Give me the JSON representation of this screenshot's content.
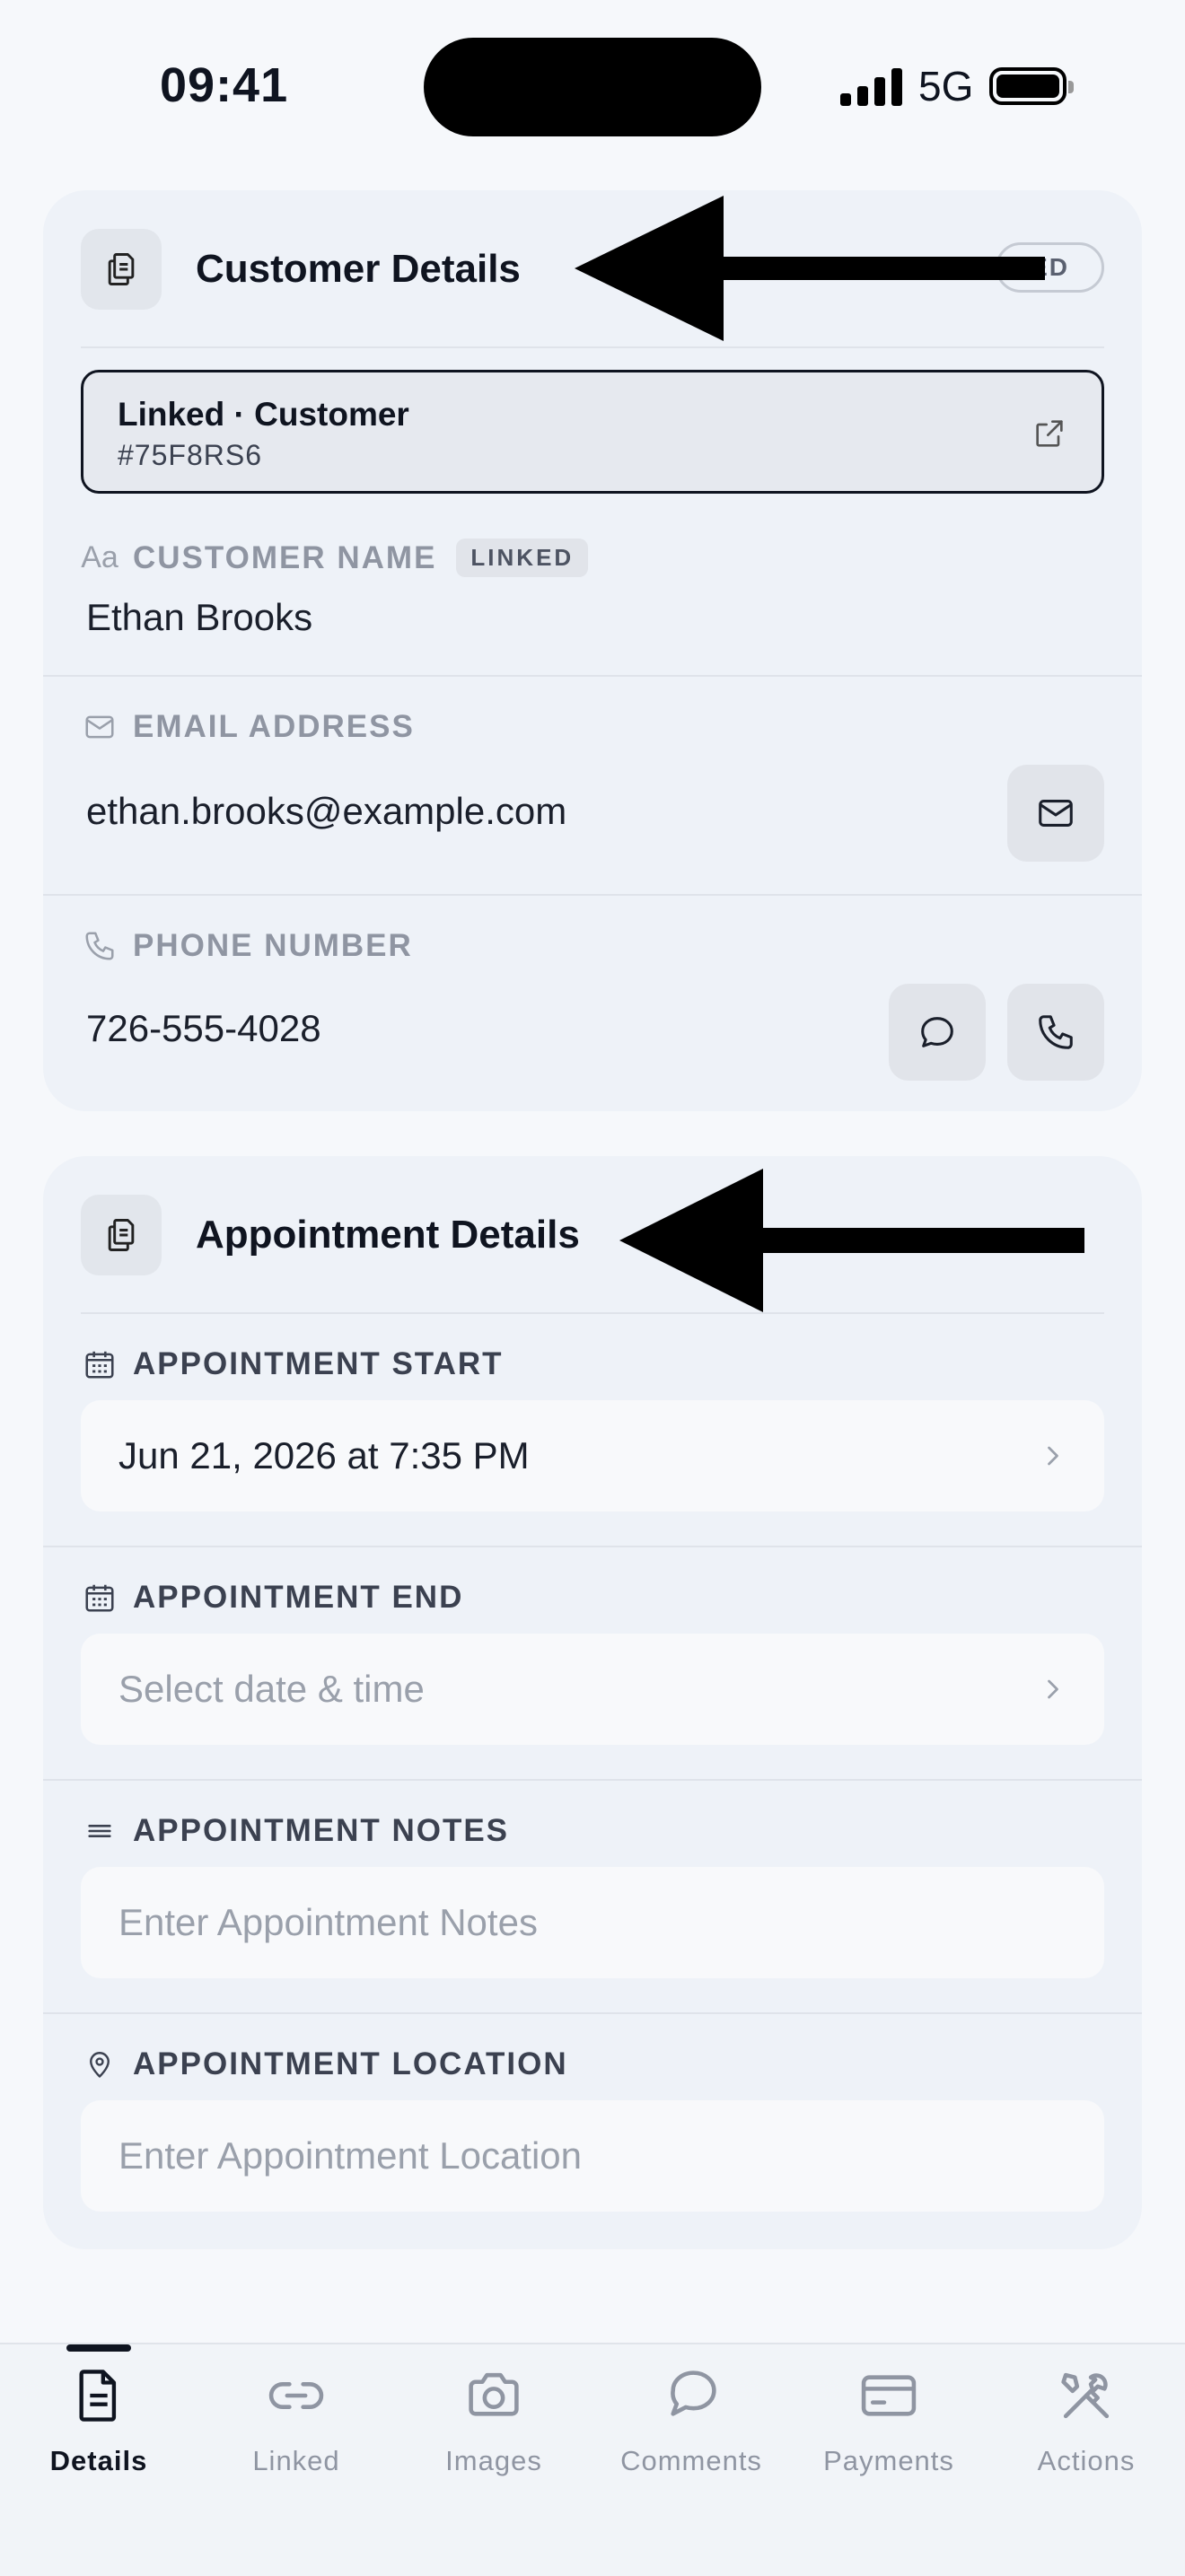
{
  "status_bar": {
    "time": "09:41",
    "network": "5G"
  },
  "customer_card": {
    "title": "Customer Details",
    "tag": "ED",
    "linked": {
      "title": "Linked · Customer",
      "id": "#75F8RS6"
    },
    "name": {
      "label": "CUSTOMER NAME",
      "badge": "LINKED",
      "icon_text": "Aa",
      "value": "Ethan Brooks"
    },
    "email": {
      "label": "EMAIL ADDRESS",
      "value": "ethan.brooks@example.com"
    },
    "phone": {
      "label": "PHONE NUMBER",
      "value": "726-555-4028"
    }
  },
  "appointment_card": {
    "title": "Appointment Details",
    "start": {
      "label": "APPOINTMENT START",
      "value": "Jun 21, 2026 at 7:35 PM"
    },
    "end": {
      "label": "APPOINTMENT END",
      "placeholder": "Select date & time"
    },
    "notes": {
      "label": "APPOINTMENT NOTES",
      "placeholder": "Enter Appointment Notes"
    },
    "location": {
      "label": "APPOINTMENT LOCATION",
      "placeholder": "Enter Appointment Location"
    }
  },
  "tabs": [
    {
      "label": "Details",
      "icon": "document-icon",
      "active": true
    },
    {
      "label": "Linked",
      "icon": "link-icon"
    },
    {
      "label": "Images",
      "icon": "camera-icon"
    },
    {
      "label": "Comments",
      "icon": "chat-bubble-icon"
    },
    {
      "label": "Payments",
      "icon": "credit-card-icon"
    },
    {
      "label": "Actions",
      "icon": "tools-icon"
    }
  ],
  "colors": {
    "accent": "#0f1420",
    "card_bg": "#eef2f8",
    "muted": "#8f95a2"
  }
}
